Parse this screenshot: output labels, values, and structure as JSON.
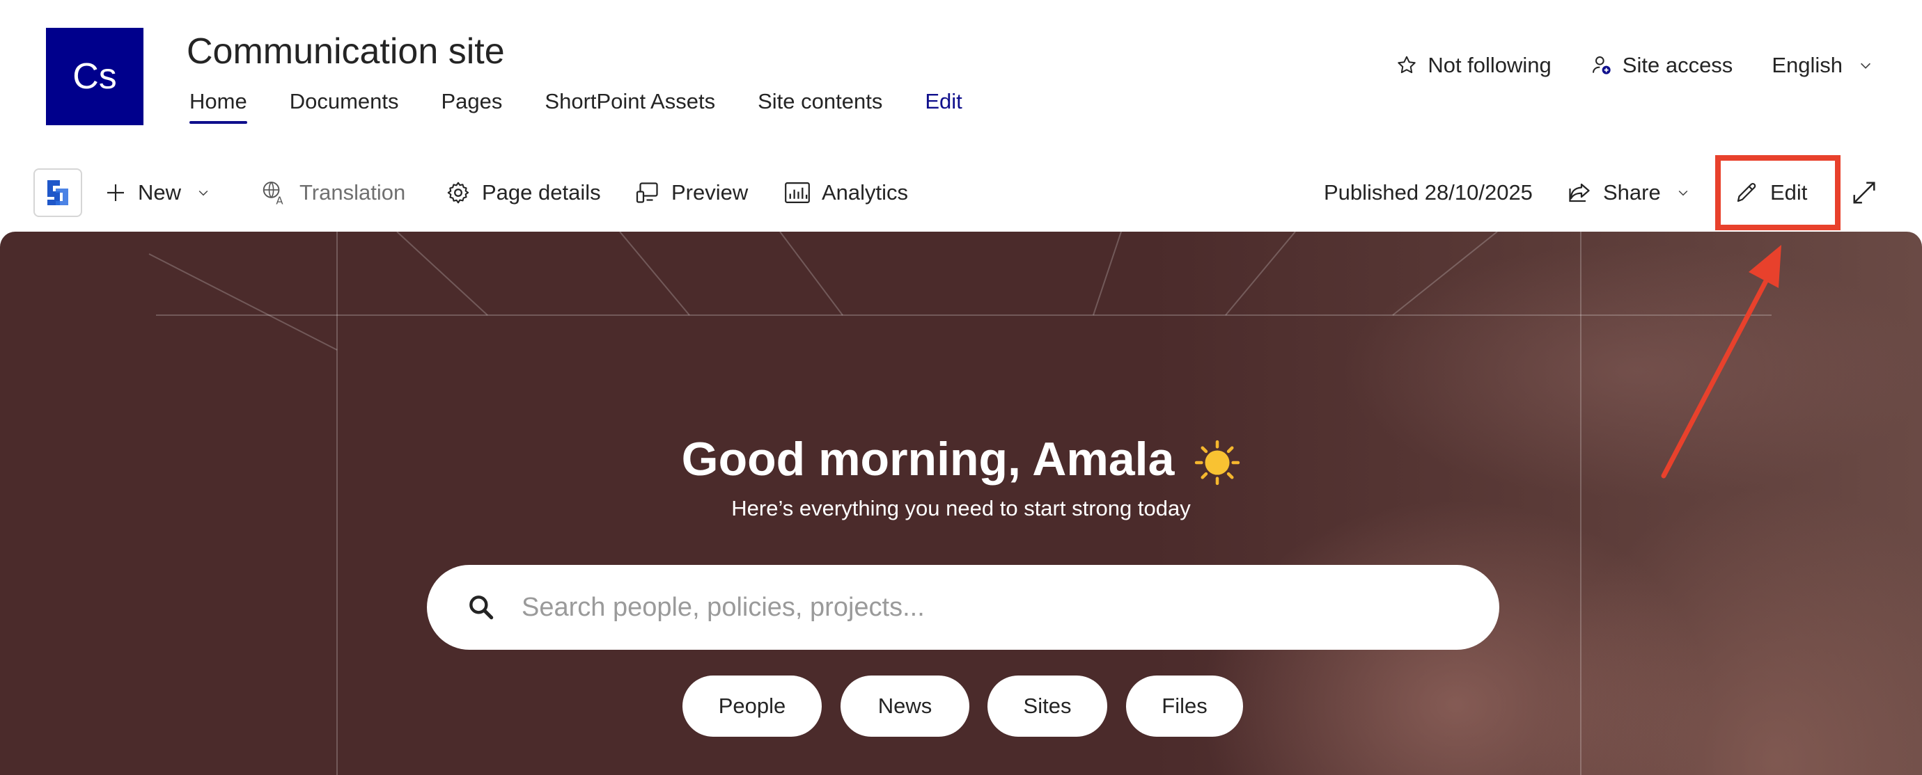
{
  "site": {
    "logo_text": "Cs",
    "title": "Communication site",
    "brand_color": "#00008c"
  },
  "nav": [
    {
      "label": "Home",
      "active": true
    },
    {
      "label": "Documents"
    },
    {
      "label": "Pages"
    },
    {
      "label": "ShortPoint Assets"
    },
    {
      "label": "Site contents"
    },
    {
      "label": "Edit"
    }
  ],
  "header_actions": {
    "follow_label": "Not following",
    "follow_icon": "star-icon",
    "site_access_label": "Site access",
    "site_access_icon": "people-settings-icon",
    "language_label": "English"
  },
  "command_bar": {
    "new_label": "New",
    "translation_label": "Translation",
    "page_details_label": "Page details",
    "preview_label": "Preview",
    "analytics_label": "Analytics",
    "published_label": "Published 28/10/2025",
    "share_label": "Share",
    "edit_label": "Edit"
  },
  "hero": {
    "greeting": "Good morning, Amala",
    "subtitle": "Here’s everything you need to start strong today",
    "search_placeholder": "Search people, policies, projects...",
    "chips": [
      "People",
      "News",
      "Sites",
      "Files"
    ]
  },
  "colors": {
    "accent": "#0f0f8c",
    "highlight": "#e8412c",
    "hero_bg": "#4b2b2b"
  }
}
